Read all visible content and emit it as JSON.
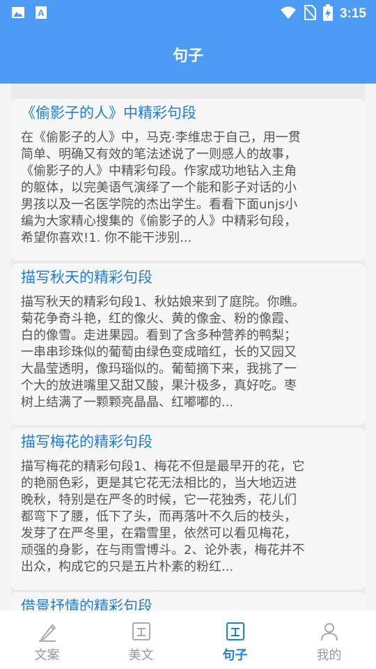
{
  "status_bar": {
    "time": "3:15",
    "icons": [
      "gallery-icon",
      "a-notification-icon",
      "wifi-icon",
      "no-sim-icon",
      "battery-charging-icon"
    ]
  },
  "header": {
    "title": "句子"
  },
  "articles": [
    {
      "title": "《偷影子的人》中精彩句段",
      "lines": [
        "在《偷影子的人》中，马克·李维忠于自己，用一贯",
        "简单、明确又有效的笔法述说了一则感人的故事，",
        "《偷影子的人》中精彩句段。作家成功地钻入主角",
        "的躯体，以完美语气演绎了一个能和影子对话的小",
        "男孩以及一名医学院的杰出学生。看看下面unjs小",
        "编为大家精心搜集的《偷影子的人》中精彩句段，",
        "希望你喜欢!1. 你不能干涉别..."
      ]
    },
    {
      "title": "描写秋天的精彩句段",
      "lines": [
        "描写秋天的精彩句段1、秋姑娘来到了庭院。你瞧。",
        "菊花争奇斗艳，红的像火、黄的像金、粉的像霞、",
        "白的像雪。走进果园。看到了含多种营养的鸭梨；",
        "一串串珍珠似的葡萄由绿色变成暗红，长的又园又",
        "大晶莹透明，像玛瑙似的。葡萄摘下来，我挑了一",
        "个大的放进嘴里又甜又酸，果汁极多，真好吃。枣",
        "树上结满了一颗颗亮晶晶、红嘟嘟的..."
      ]
    },
    {
      "title": "描写梅花的精彩句段",
      "lines": [
        "描写梅花的精彩句段1、梅花不但是最早开的花，它",
        "的艳丽色彩，更是其它花无法相比的，当大地迈进",
        "晚秋，特别是在严冬的时候，它一花独秀，花儿们",
        "都弯下了腰，低下了头，而再落叶不久后的枝头，",
        "发芽了在严冬里，在霜雪里，依然可以看见梅花，",
        "顽强的身影，在与雨雪博斗。2、论外表，梅花并不",
        "出众，构成它的只是五片朴素的粉红..."
      ]
    },
    {
      "title": "借景抒情的精彩句段",
      "lines": []
    }
  ],
  "tabbar": {
    "tabs": [
      {
        "label": "文案",
        "icon": "pen-icon",
        "active": false
      },
      {
        "label": "美文",
        "icon": "article-icon",
        "active": false
      },
      {
        "label": "句子",
        "icon": "sentence-icon",
        "active": true
      },
      {
        "label": "我的",
        "icon": "person-icon",
        "active": false
      }
    ]
  },
  "colors": {
    "primary": "#4C9BF5",
    "title_blue": "#1E7FD3",
    "tab_inactive": "#999999"
  }
}
